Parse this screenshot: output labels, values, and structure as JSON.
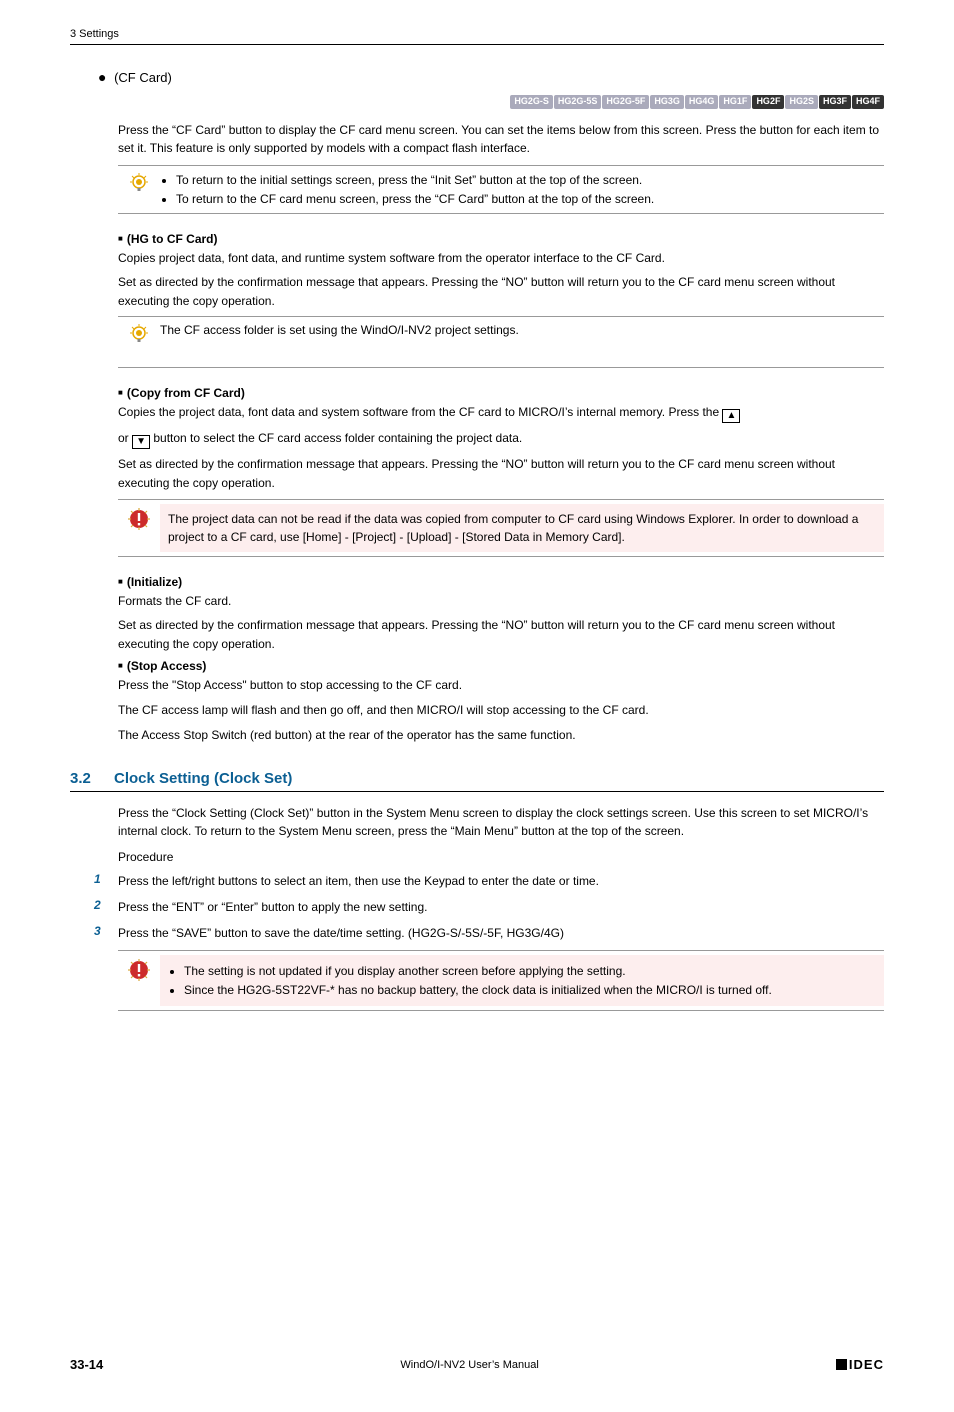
{
  "header": {
    "chapter": "3 Settings"
  },
  "cfcard": {
    "title": "(CF Card)",
    "badges": [
      {
        "label": "HG2G-S",
        "active": false
      },
      {
        "label": "HG2G-5S",
        "active": false
      },
      {
        "label": "HG2G-5F",
        "active": false
      },
      {
        "label": "HG3G",
        "active": false
      },
      {
        "label": "HG4G",
        "active": false
      },
      {
        "label": "HG1F",
        "active": false
      },
      {
        "label": "HG2F",
        "active": true
      },
      {
        "label": "HG2S",
        "active": false
      },
      {
        "label": "HG3F",
        "active": true
      },
      {
        "label": "HG4F",
        "active": true
      }
    ],
    "intro": "Press the “CF Card” button to display the CF card menu screen. You can set the items below from this screen. Press the button for each item to set it. This feature is only supported by models with a compact flash interface.",
    "tip1": [
      "To return to the initial settings screen, press the “Init Set” button at the top of the screen.",
      "To return to the CF card menu screen, press the “CF Card” button at the top of the screen."
    ],
    "hg_to_cf": {
      "title": "(HG to CF Card)",
      "p1": "Copies project data, font data, and runtime system software from the operator interface to the CF Card.",
      "p2": "Set as directed by the confirmation message that appears. Pressing the “NO” button will return you to the CF card menu screen without executing the copy operation.",
      "tip": "The CF access folder is set using the WindO/I-NV2 project settings."
    },
    "copy_from": {
      "title": "(Copy from CF Card)",
      "p1a": "Copies the project data, font data and system software from the CF card to MICRO/I’s internal memory. Press the ",
      "p1b": "or ",
      "p1c": " button to select the CF card access folder containing the project data.",
      "p2": "Set as directed by the confirmation message that appears. Pressing the “NO” button will return you to the CF card menu screen without executing the copy operation.",
      "warn": "The project data can not be read if the data was copied from computer to CF card using Windows Explorer. In order to download a project to a CF card, use [Home] - [Project] - [Upload] - [Stored Data in Memory Card]."
    },
    "initialize": {
      "title": "(Initialize)",
      "p1": "Formats the CF card.",
      "p2": "Set as directed by the confirmation message that appears. Pressing the “NO” button will return you to the CF card menu screen without executing the copy operation."
    },
    "stop_access": {
      "title": "(Stop Access)",
      "p1": "Press the \"Stop Access\" button to stop accessing to the CF card.",
      "p2": "The CF access lamp will flash and then go off, and then MICRO/I will stop accessing to the CF card.",
      "p3": "The Access Stop Switch (red button) at the rear of the operator has the same function."
    }
  },
  "clock": {
    "num": "3.2",
    "title": "Clock Setting (Clock Set)",
    "intro": "Press the “Clock Setting (Clock Set)” button in the System Menu screen to display the clock settings screen. Use this screen to set MICRO/I’s internal clock. To return to the System Menu screen, press the “Main Menu” button at the top of the screen.",
    "procedure_label": "Procedure",
    "steps": [
      "Press the left/right buttons to select an item, then use the Keypad to enter the date or time.",
      "Press the “ENT” or “Enter” button to apply the new setting.",
      "Press the “SAVE” button to save the date/time setting. (HG2G-S/-5S/-5F, HG3G/4G)"
    ],
    "warn": [
      "The setting is not updated if you display another screen before applying the setting.",
      "Since the HG2G-5ST22VF-* has no backup battery, the clock data is initialized when the MICRO/I is turned off."
    ]
  },
  "footer": {
    "page": "33-14",
    "manual": "WindO/I-NV2 User’s Manual",
    "logo": "IDEC"
  }
}
